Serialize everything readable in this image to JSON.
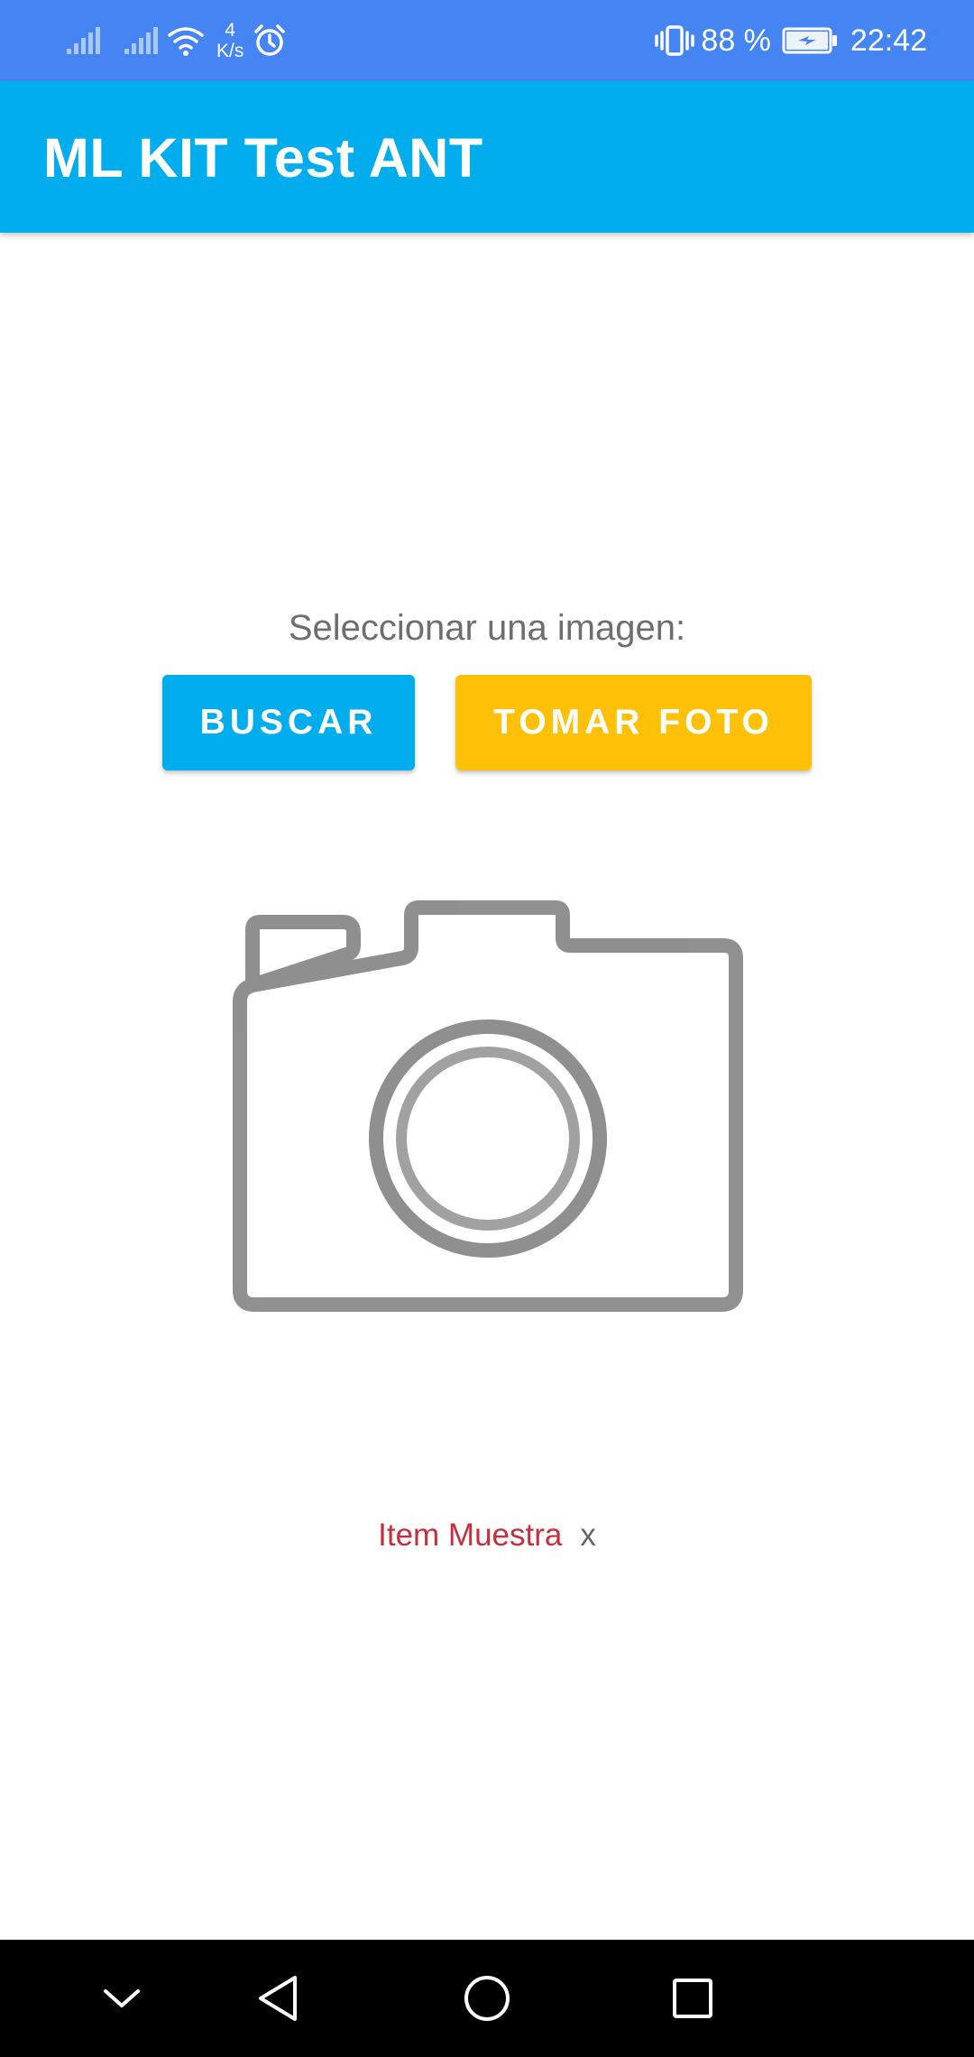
{
  "status_bar": {
    "net_speed_value": "4",
    "net_speed_unit": "K/s",
    "battery_percent": "88 %",
    "time": "22:42",
    "icons": [
      "signal-icon",
      "signal-icon",
      "wifi-icon",
      "alarm-icon",
      "vibrate-icon",
      "battery-charging-icon"
    ]
  },
  "app_bar": {
    "title": "ML KIT Test ANT"
  },
  "main": {
    "prompt": "Seleccionar una imagen:",
    "search_button": "BUSCAR",
    "take_photo_button": "TOMAR FOTO",
    "image_placeholder_icon": "camera-icon",
    "result_item": {
      "label": "Item Muestra",
      "close": "x"
    }
  },
  "nav_bar": {
    "icons": [
      "chevron-down-icon",
      "back-icon",
      "home-icon",
      "recents-icon"
    ]
  },
  "colors": {
    "status_bar": "#4585f3",
    "app_bar": "#02adee",
    "search_button": "#02adee",
    "take_photo_button": "#ffc107",
    "item_label": "#c62f3d"
  }
}
